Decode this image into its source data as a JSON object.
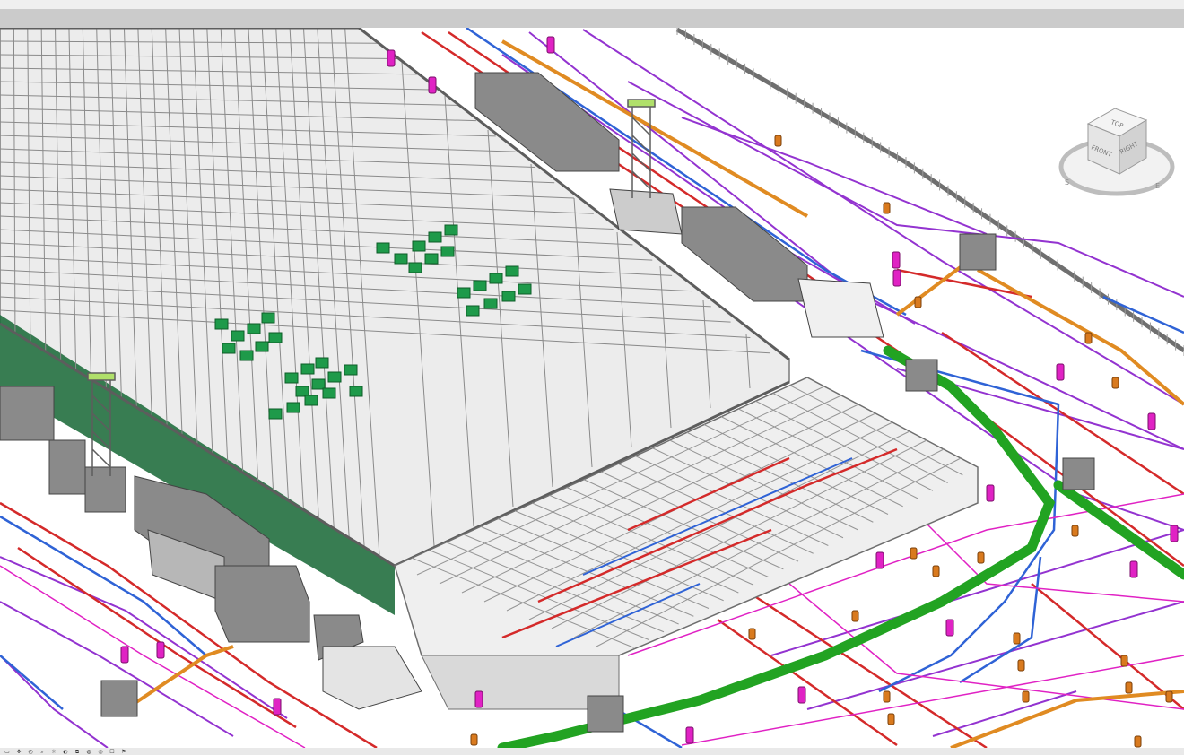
{
  "viewcube": {
    "top_label": "TOP",
    "front_label": "FRONT",
    "right_label": "RIGHT",
    "compass_labels": [
      "S",
      "E"
    ]
  },
  "statusbar": {
    "tools": [
      {
        "icon": "workset-icon",
        "glyph": "▭"
      },
      {
        "icon": "pan-icon",
        "glyph": "✥"
      },
      {
        "icon": "orbit-icon",
        "glyph": "◴"
      },
      {
        "icon": "zoom-icon",
        "glyph": "⌕"
      },
      {
        "icon": "sun-icon",
        "glyph": "☼"
      },
      {
        "icon": "shadows-icon",
        "glyph": "◐"
      },
      {
        "icon": "crop-icon",
        "glyph": "⧉"
      },
      {
        "icon": "hide-icon",
        "glyph": "◍"
      },
      {
        "icon": "temporary-hide-icon",
        "glyph": "◎"
      },
      {
        "icon": "reveal-icon",
        "glyph": "☐"
      },
      {
        "icon": "analysis-icon",
        "glyph": "⚑"
      }
    ]
  },
  "colors": {
    "structure": "#8d8d8d",
    "green_pipe": "#22a322",
    "red_pipe": "#d42a2a",
    "blue_pipe": "#2f63d6",
    "purple_pipe": "#9333d0",
    "magenta_pipe": "#e022c4",
    "orange_pipe": "#e08b22",
    "equipment": "#7c7c7c",
    "panel_green": "#1d6b3a"
  }
}
